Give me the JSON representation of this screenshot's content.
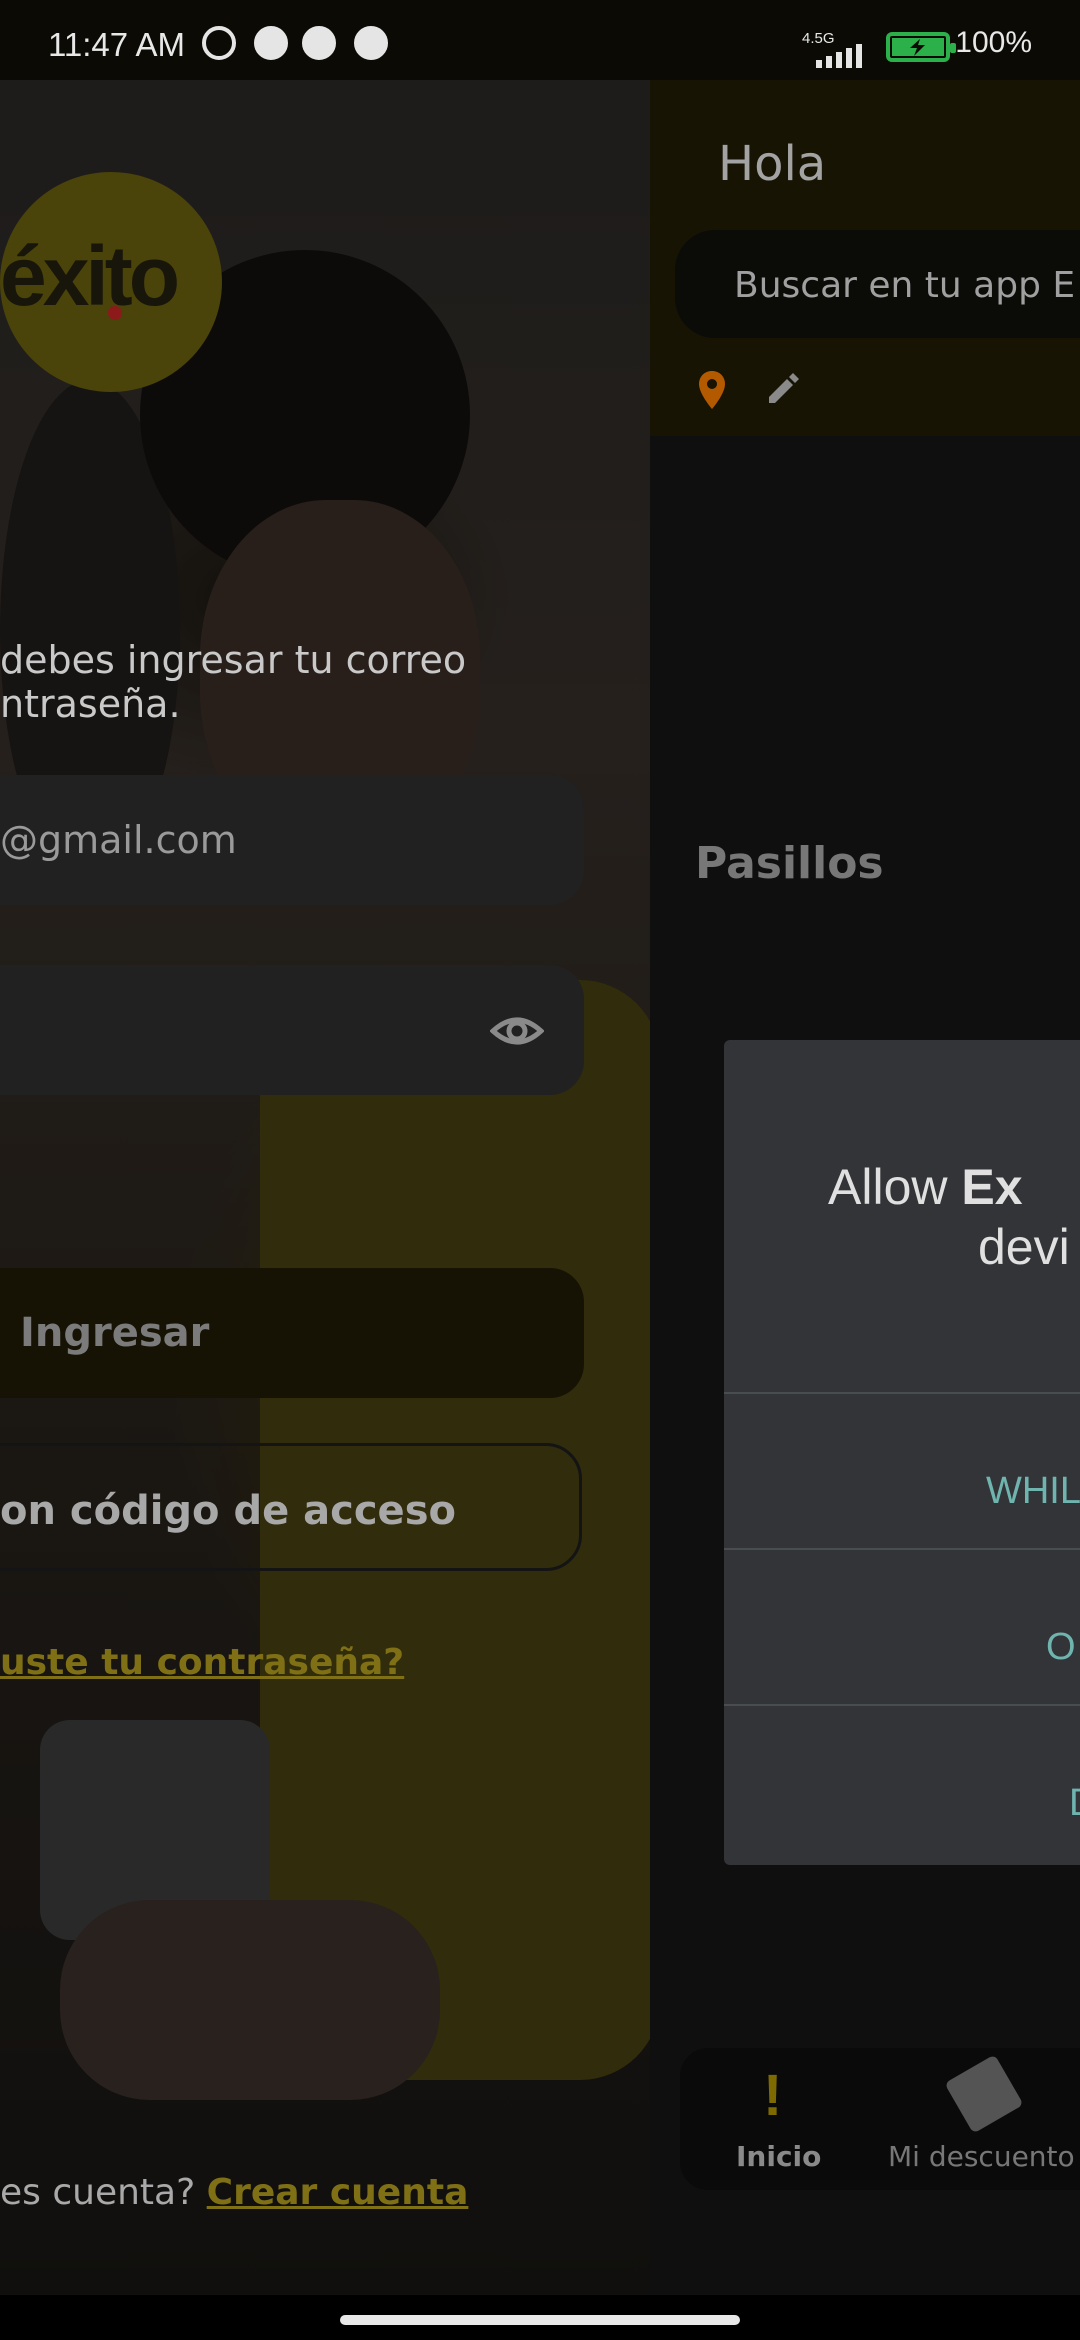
{
  "status_bar": {
    "time": "11:47 AM",
    "network": "4.5G",
    "battery": "100%"
  },
  "login": {
    "logo_text": "éxito",
    "intro": [
      "debes ingresar tu correo",
      "ntraseña."
    ],
    "email_value": "@gmail.com",
    "ingresar_label": "Ingresar",
    "codigo_label": "on código de acceso",
    "forgot_label": "uste tu contraseña?",
    "no_account_text": "es cuenta?",
    "create_account_label": "Crear cuenta"
  },
  "home": {
    "greeting": "Hola",
    "search_placeholder": "Buscar en tu app E",
    "section_title": "Pasillos",
    "nav": {
      "inicio": "Inicio",
      "descuentos": "Mi descuento"
    }
  },
  "dialog": {
    "title_prefix": "Allow ",
    "title_bold": "Ex",
    "title_line2": "devi",
    "option_while": "WHIL",
    "option_once": "O",
    "option_deny": "D"
  },
  "colors": {
    "accent_yellow": "#807015",
    "dialog_option": "#6fb4ae",
    "battery_green": "#2bb04a",
    "location_pin": "#b35a00"
  }
}
